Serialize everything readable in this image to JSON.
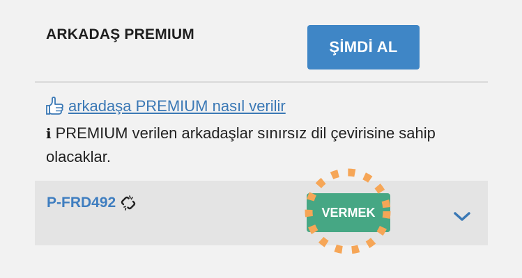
{
  "header": {
    "title": "ARKADAŞ PREMIUM",
    "buy_label": "ŞİMDİ AL"
  },
  "info": {
    "howto_icon": "thumbs-up-hand-icon",
    "howto_link": "arkadaşa PREMIUM nasıl verilir",
    "info_icon": "info-icon",
    "description": "PREMIUM verilen arkadaşlar sınırsız dil çevirisine sahip olacaklar."
  },
  "code_row": {
    "code": "P-FRD492",
    "code_icon": "broken-link-icon",
    "give_label": "VERMEK",
    "expand_icon": "chevron-down-icon"
  },
  "colors": {
    "buy_button": "#3f86c6",
    "give_button": "#46a784",
    "link": "#3a78b5",
    "highlight": "#f6a657"
  }
}
